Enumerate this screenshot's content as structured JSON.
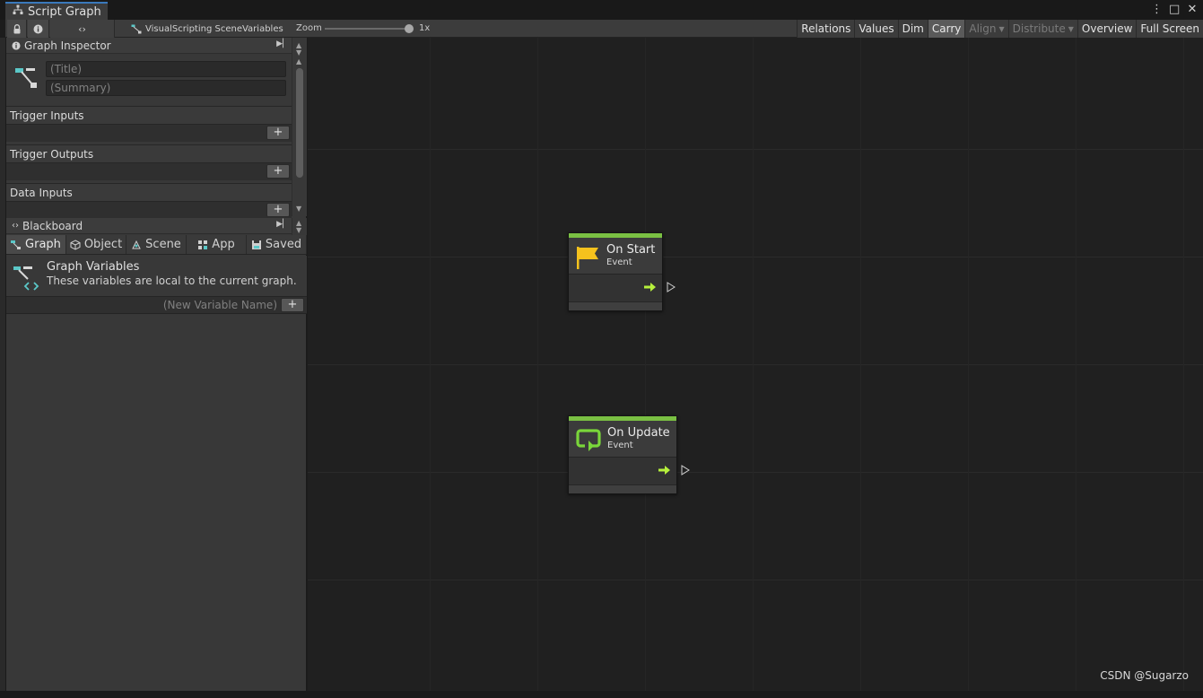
{
  "window": {
    "title": "Script Graph",
    "controls": {
      "more": "⋮",
      "maximize": "□",
      "close": "✕"
    }
  },
  "toolbar": {
    "lock_icon": "lock-icon",
    "info_icon": "info-icon",
    "variables_icon": "variables-icon",
    "variables_glyph": "‹›",
    "breadcrumb": "VisualScripting SceneVariables",
    "zoom_label": "Zoom",
    "zoom_value": "1x",
    "zoom_level": 1.0,
    "buttons": {
      "relations": "Relations",
      "values": "Values",
      "dim": "Dim",
      "carry": "Carry",
      "align": "Align",
      "distribute": "Distribute",
      "overview": "Overview",
      "fullscreen": "Full Screen"
    }
  },
  "inspector": {
    "header": "Graph Inspector",
    "title_placeholder": "(Title)",
    "summary_placeholder": "(Summary)",
    "sections": {
      "trigger_inputs": "Trigger Inputs",
      "trigger_outputs": "Trigger Outputs",
      "data_inputs": "Data Inputs"
    },
    "add_label": "+"
  },
  "blackboard": {
    "header": "Blackboard",
    "tabs": {
      "graph": "Graph",
      "object": "Object",
      "scene": "Scene",
      "app": "App",
      "saved": "Saved"
    },
    "selected_tab": "Graph",
    "section_title": "Graph Variables",
    "section_desc": "These variables are local to the current graph.",
    "new_var_placeholder": "(New Variable Name)",
    "add_label": "+"
  },
  "nodes": {
    "on_start": {
      "title": "On Start",
      "subtitle": "Event",
      "icon": "flag-icon"
    },
    "on_update": {
      "title": "On Update",
      "subtitle": "Event",
      "icon": "loop-icon"
    }
  },
  "colors": {
    "event_green": "#7ac043",
    "flag_yellow": "#f5c21d",
    "accent_teal": "#5bc8c8",
    "tab_accent": "#3a79bb"
  },
  "watermark": "CSDN @Sugarzo"
}
